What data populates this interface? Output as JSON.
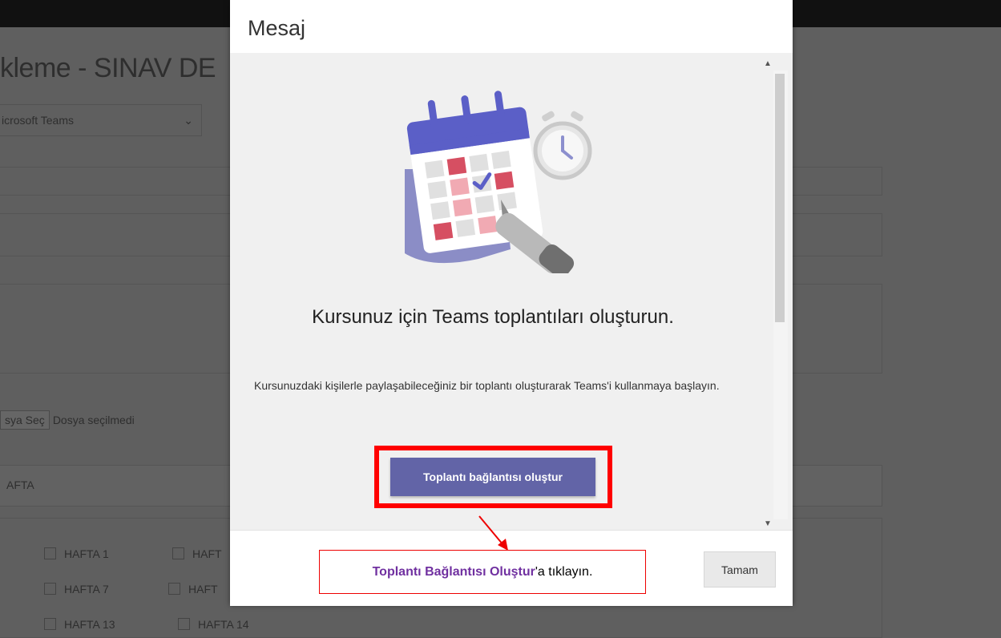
{
  "background_page": {
    "title": "kleme - SINAV DE",
    "select_value": "icrosoft Teams",
    "file_button": "sya Seç",
    "file_status": "Dosya seçilmedi",
    "section_label": "AFTA",
    "weeks": [
      "HAFTA 1",
      "HAFT",
      "HAFTA 7",
      "HAFT",
      "HAFTA 13",
      "HAFTA 14"
    ]
  },
  "modal": {
    "title": "Mesaj",
    "headline": "Kursunuz için Teams toplantıları oluşturun.",
    "body": "Kursunuzdaki kişilerle paylaşabileceğiniz bir toplantı oluşturarak Teams'i kullanmaya başlayın.",
    "primary_button": "Toplantı bağlantısı oluştur",
    "ok_button": "Tamam"
  },
  "annotation": {
    "bold_text": "Toplantı Bağlantısı Oluştur",
    "rest_text": "'a tıklayın."
  },
  "colors": {
    "teams_purple": "#6264a7",
    "highlight_red": "#ff0000",
    "annotation_purple": "#7030a0"
  }
}
